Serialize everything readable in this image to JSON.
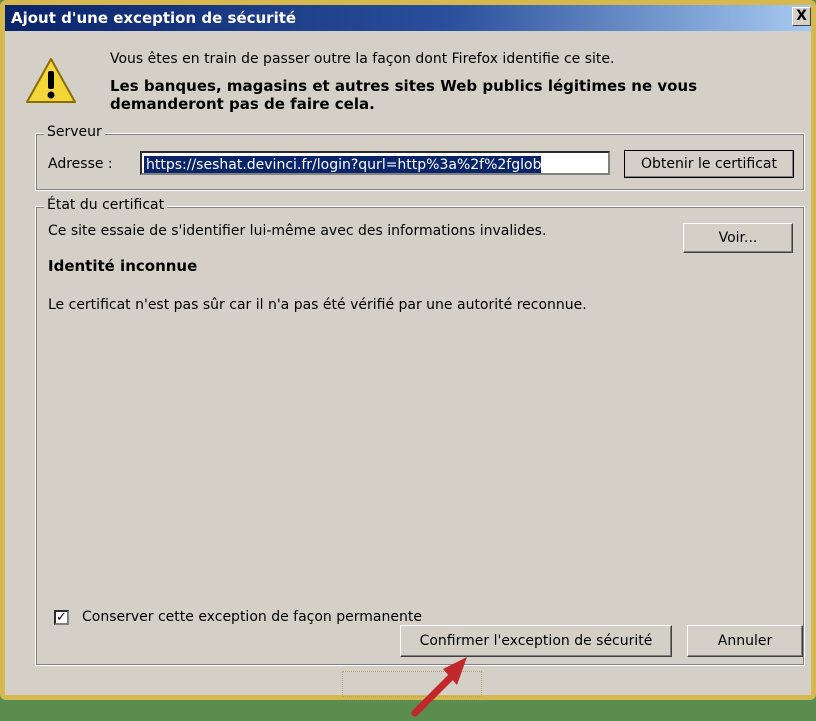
{
  "window": {
    "title": "Ajout d'une exception de sécurité",
    "close_label": "X"
  },
  "intro": {
    "line1": "Vous êtes en train de passer outre la façon dont Firefox identifie ce site.",
    "line2": "Les banques, magasins et autres sites Web publics légitimes ne vous demanderont pas de faire cela."
  },
  "server": {
    "legend": "Serveur",
    "address_label": "Adresse :",
    "address_value": "https://seshat.devinci.fr/login?qurl=http%3a%2f%2fglob",
    "get_cert_button": "Obtenir le certificat"
  },
  "certificate": {
    "legend": "État du certificat",
    "message": "Ce site essaie de s'identifier lui-même avec des informations invalides.",
    "view_button": "Voir...",
    "identity_title": "Identité inconnue",
    "detail": "Le certificat n'est pas sûr car il n'a pas été vérifié par une autorité reconnue."
  },
  "permanent": {
    "label": "Conserver cette exception de façon permanente",
    "checked": true
  },
  "buttons": {
    "confirm": "Confirmer l'exception de sécurité",
    "cancel": "Annuler"
  },
  "colors": {
    "titlebar_start": "#0a246a",
    "titlebar_end": "#a6caf0",
    "dialog_bg": "#d4d0c8",
    "frame": "#d7b84e",
    "arrow": "#c0282b",
    "warning": "#f4d53a"
  },
  "icons": {
    "warning": "warning-icon",
    "close": "close-icon",
    "check": "checkmark-icon",
    "pointer": "red-arrow-annotation"
  }
}
